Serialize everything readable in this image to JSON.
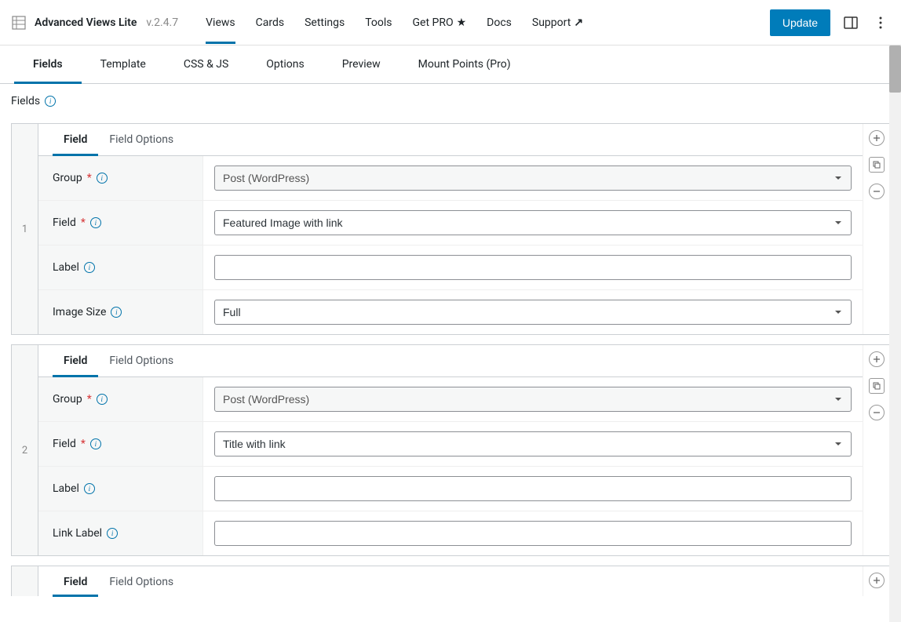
{
  "app": {
    "title": "Advanced Views Lite",
    "version": "v.2.4.7"
  },
  "topnav": {
    "items": [
      "Views",
      "Cards",
      "Settings",
      "Tools",
      "Get PRO",
      "Docs",
      "Support"
    ],
    "active_index": 0
  },
  "update_button": "Update",
  "tabs": {
    "items": [
      "Fields",
      "Template",
      "CSS & JS",
      "Options",
      "Preview",
      "Mount Points (Pro)"
    ],
    "active_index": 0
  },
  "section_title": "Fields",
  "subtabs": {
    "field": "Field",
    "field_options": "Field Options"
  },
  "labels": {
    "group": "Group",
    "field": "Field",
    "label": "Label",
    "image_size": "Image Size",
    "link_label": "Link Label"
  },
  "blocks": [
    {
      "num": "1",
      "group": "Post (WordPress)",
      "field": "Featured Image with link",
      "label_val": "",
      "extra_label": "Image Size",
      "extra_value": "Full",
      "extra_type": "select"
    },
    {
      "num": "2",
      "group": "Post (WordPress)",
      "field": "Title with link",
      "label_val": "",
      "extra_label": "Link Label",
      "extra_value": "",
      "extra_type": "text"
    }
  ]
}
